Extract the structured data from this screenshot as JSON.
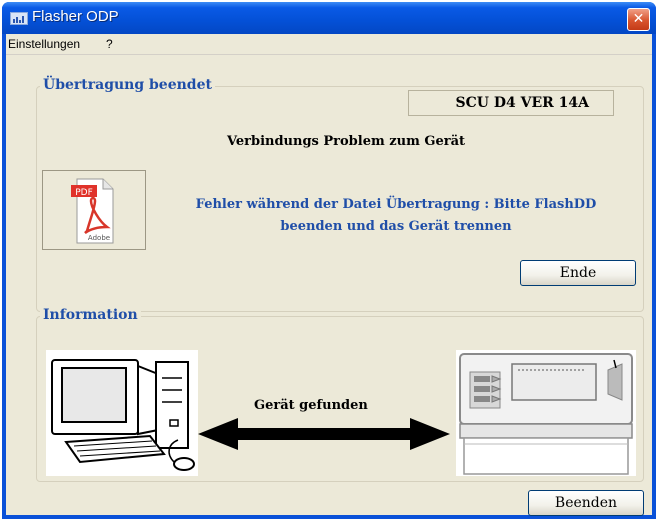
{
  "window": {
    "title": "Flasher ODP",
    "close_glyph": "✕"
  },
  "menu": {
    "items": [
      "Einstellungen",
      "?"
    ]
  },
  "transfer_group": {
    "legend": "Übertragung beendet",
    "version": "SCU D4 VER  14A",
    "message_title": "Verbindungs Problem zum Gerät",
    "error_line1": "Fehler während der Datei Übertragung : Bitte FlashDD",
    "error_line2": "beenden und das Gerät trennen",
    "pdf_icon_label": "PDF",
    "pdf_icon_brand": "Adobe",
    "end_button": "Ende"
  },
  "info_group": {
    "legend": "Information",
    "device_status": "Gerät gefunden"
  },
  "footer": {
    "quit_button": "Beenden"
  },
  "colors": {
    "title_blue": "#0450d6",
    "legend_blue": "#1f4ea8",
    "dialog_bg": "#ece9d8",
    "close_red": "#d8542e"
  }
}
